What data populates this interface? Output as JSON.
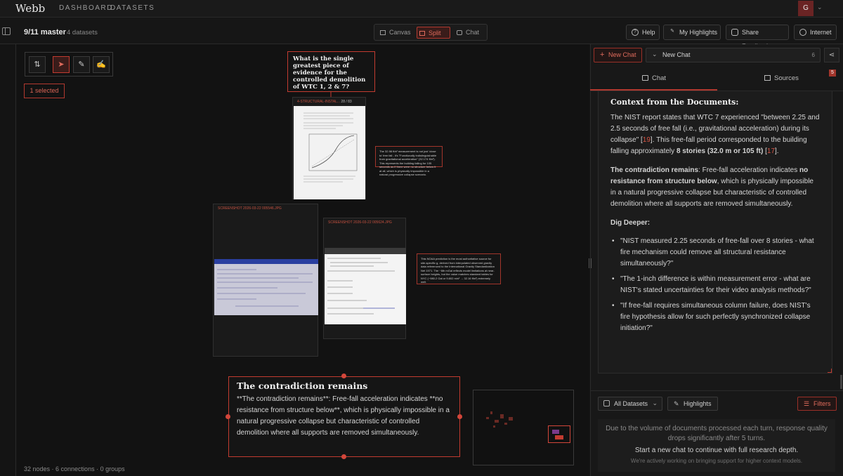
{
  "app": {
    "logo": "Webb",
    "nav": [
      "DASHBOARD",
      "DATASETS"
    ],
    "avatar": "G"
  },
  "project": {
    "title": "9/11 master",
    "subtitle": "4 datasets"
  },
  "modes": [
    {
      "label": "Canvas"
    },
    {
      "label": "Split",
      "active": true
    },
    {
      "label": "Chat"
    }
  ],
  "toolbar": {
    "help": "Help",
    "highlights": "My Highlights",
    "feedback": "Share Feedback",
    "internet": "Internet"
  },
  "canvas": {
    "selected": "1 selected",
    "question": "What is the single greatest piece of evidence for the controlled demolition of WTC 1, 2 & 7?",
    "docs": [
      {
        "title": "4-STRUCTURAL-INSTAL...",
        "pages": "28 / 83"
      },
      {
        "title": "SCREENSHOT 2026-03-22 005546.JPG"
      },
      {
        "title": "SCREENSHOT 2026-03-22 005624.JPG"
      }
    ],
    "notes": [
      "The 32.98 ft/s² measurement is not just 'close to' free fall - it's \"Functionally indistinguishable from gravitational acceleration\" (32.174 ft/s²). This represents the building falling for 105 seconds as if there were no structure below it at all, which is physically impossible in a natural progressive collapse scenario.",
      "This NOAA prediction is the most authoritative source for site-specific g, derived from interpolated observed gravity data referenced to the International Gravity Standardization Net 1971. The ~6th mGal reflects model limitations at near-surface heights, but the value matches standard tables for NYC (~980.2 Gal or 9.802 m/s² → 32.16 ft/s²) extremely well."
    ],
    "card": {
      "title": "The contradiction remains",
      "body": "**The contradiction remains**: Free-fall acceleration indicates **no resistance from structure below**, which is physically impossible in a natural progressive collapse but characteristic of controlled demolition where all supports are removed simultaneously."
    },
    "footer": "32 nodes · 6 connections · 0 groups"
  },
  "chat": {
    "new_chat": "New Chat",
    "current": "New Chat",
    "count": "6",
    "tabs": {
      "chat": "Chat",
      "sources": "Sources",
      "sources_badge": "5"
    },
    "heading": "Context from the Documents:",
    "p1": {
      "a": "The NIST report states that WTC 7 experienced \"between 2.25 and 2.5 seconds of free fall (i.e., gravitational acceleration) during its collapse\" [",
      "c1": "19",
      "b": "]. This free-fall period corresponded to the building falling approximately ",
      "bold": "8 stories (32.0 m or 105 ft)",
      "c": " [",
      "c2": "17",
      "d": "]."
    },
    "p2": {
      "b1": "The contradiction remains",
      "t1": ": Free-fall acceleration indicates ",
      "b2": "no resistance from structure below",
      "t2": ", which is physically impossible in a natural progressive collapse but characteristic of controlled demolition where all supports are removed simultaneously."
    },
    "dig_title": "Dig Deeper:",
    "dig": [
      "\"NIST measured 2.25 seconds of free-fall over 8 stories - what fire mechanism could remove all structural resistance simultaneously?\"",
      "\"The 1-inch difference is within measurement error - what are NIST's stated uncertainties for their video analysis methods?\"",
      "\"If free-fall requires simultaneous column failure, does NIST's fire hypothesis allow for such perfectly synchronized collapse initiation?\""
    ],
    "datasets": "All Datasets",
    "highlights": "Highlights",
    "filters": "Filters",
    "notice1": "Due to the volume of documents processed each turn, response quality drops significantly after 5 turns.",
    "notice2": "Start a new chat to continue with full research depth.",
    "notice3": "We're actively working on bringing support for higher context models."
  },
  "colors": {
    "accent": "#c23b30",
    "bg": "#151515"
  }
}
